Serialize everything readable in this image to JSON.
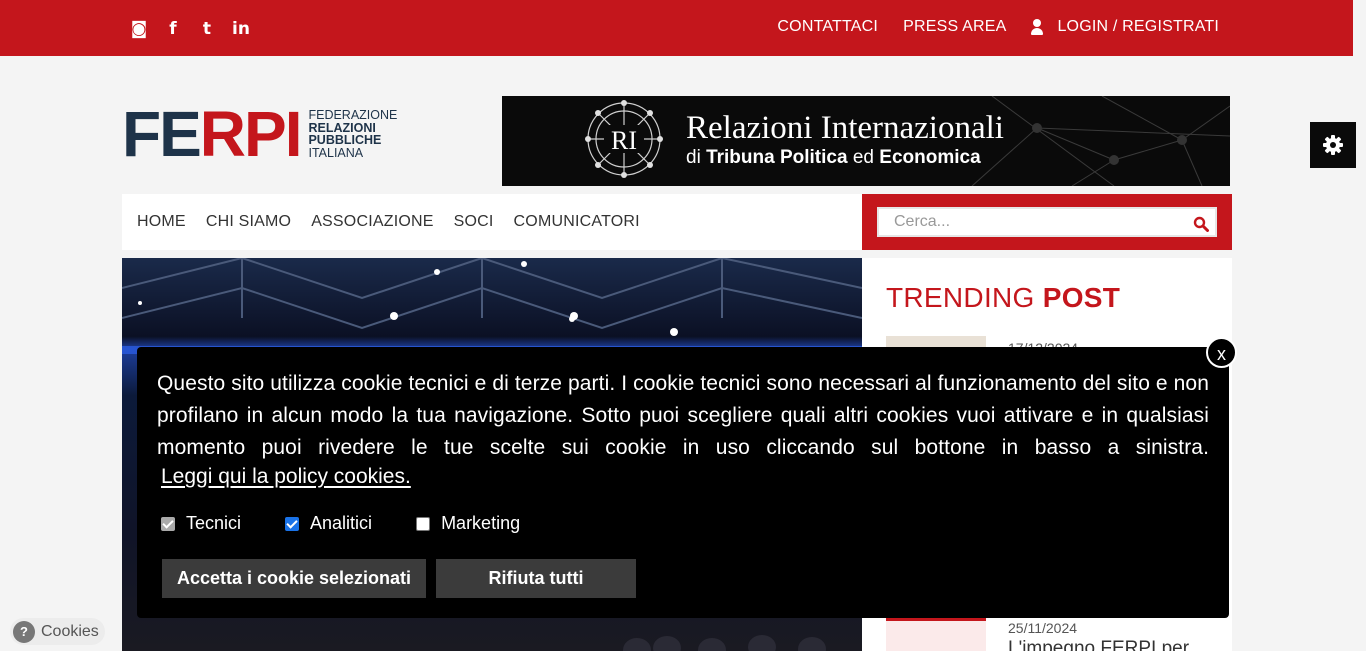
{
  "topbar": {
    "social_icons": [
      "rss-icon",
      "facebook-icon",
      "twitter-icon",
      "linkedin-icon"
    ],
    "social_glyphs": [
      "◙",
      "f",
      "t",
      "in"
    ],
    "links": {
      "contact": "CONTATTACI",
      "press": "PRESS AREA",
      "login": "LOGIN / REGISTRATI"
    }
  },
  "logo": {
    "mark_a": "FE",
    "mark_b": "RPI",
    "line1": "FEDERAZIONE",
    "line2": "RELAZIONI",
    "line3": "PUBBLICHE",
    "line4": "ITALIANA"
  },
  "banner": {
    "emblem": "RI",
    "title": "Relazioni Internazionali",
    "sub_a": "di",
    "sub_b": "Tribuna Politica",
    "sub_c": "ed",
    "sub_d": "Economica"
  },
  "nav": {
    "items": [
      "HOME",
      "CHI SIAMO",
      "ASSOCIAZIONE",
      "SOCI",
      "COMUNICATORI"
    ]
  },
  "search": {
    "placeholder": "Cerca..."
  },
  "sidebar": {
    "title_a": "TRENDING",
    "title_b": "POST",
    "post1_date": "17/12/2024",
    "post2_date": "25/11/2024",
    "post2_title": "L'impegno FERPI per"
  },
  "cookie_banner": {
    "text": "Questo sito utilizza cookie tecnici e di terze parti. I cookie tecnici sono necessari al funzionamento del sito e non profilano in alcun modo la tua navigazione. Sotto puoi scegliere quali altri cookies vuoi attivare e in qualsiasi momento puoi rivedere le tue scelte sui cookie in uso cliccando sul bottone in basso a sinistra.",
    "policy_link": "Leggi qui la policy cookies.",
    "options": [
      {
        "label": "Tecnici",
        "state": "checked-disabled"
      },
      {
        "label": "Analitici",
        "state": "checked"
      },
      {
        "label": "Marketing",
        "state": "unchecked"
      }
    ],
    "accept_label": "Accetta i cookie selezionati",
    "reject_label": "Rifiuta tutti",
    "close_label": "x"
  },
  "cookies_pill": {
    "icon": "?",
    "label": "Cookies"
  },
  "colors": {
    "brand_red": "#c4161c",
    "navy": "#1e3349",
    "modal": "#000000"
  }
}
